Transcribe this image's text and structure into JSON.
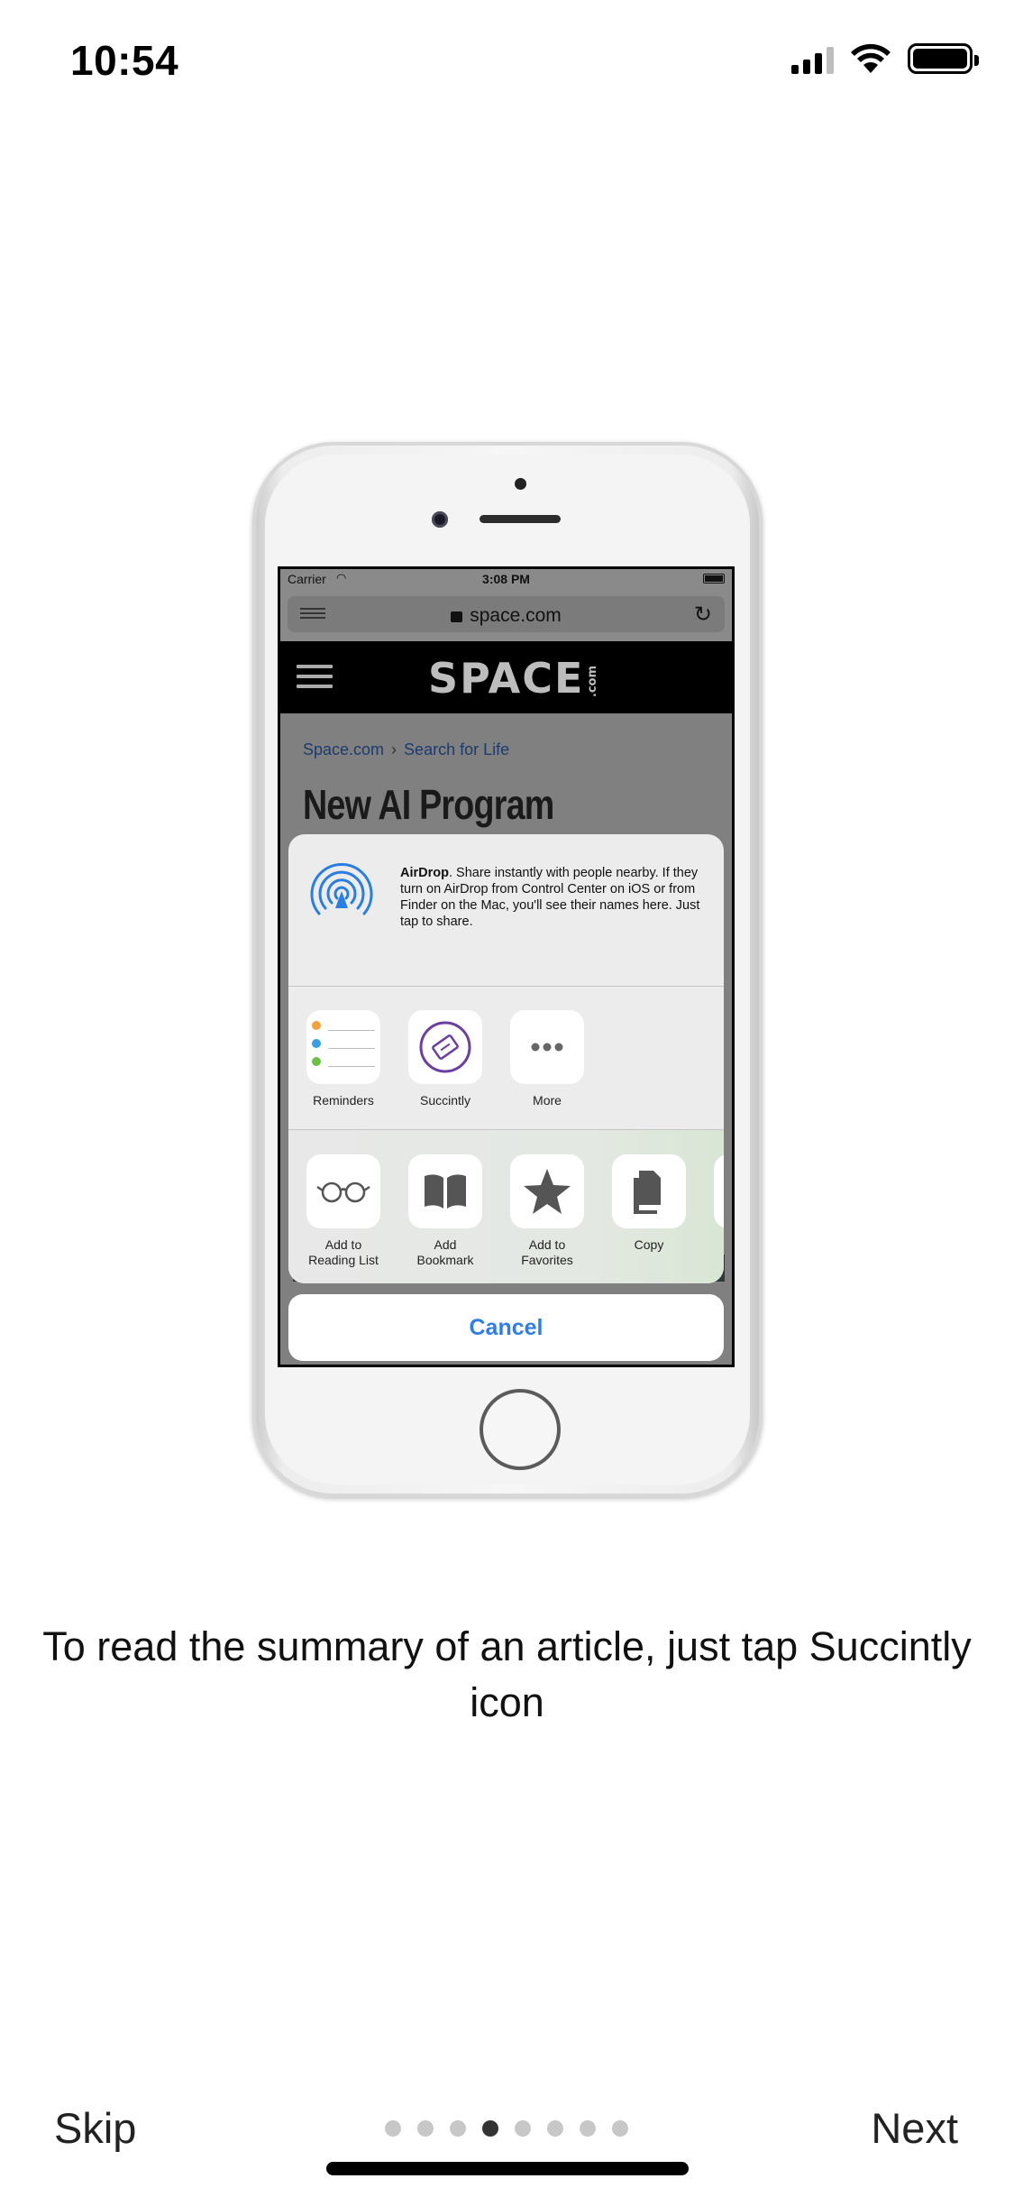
{
  "status_bar": {
    "time": "10:54"
  },
  "phone_screen": {
    "status": {
      "carrier": "Carrier",
      "time": "3:08 PM"
    },
    "url": "space.com",
    "site_logo": "SPACE",
    "site_logo_suffix": ".com",
    "breadcrumb": [
      "Space.com",
      "Search for Life"
    ],
    "headline": "New AI Program"
  },
  "share_sheet": {
    "airdrop_title": "AirDrop",
    "airdrop_text": ". Share instantly with people nearby. If they turn on AirDrop from Control Center on iOS or from Finder on the Mac, you'll see their names here. Just tap to share.",
    "apps": [
      {
        "label": "Reminders",
        "icon": "reminders-icon"
      },
      {
        "label": "Succintly",
        "icon": "succintly-icon"
      },
      {
        "label": "More",
        "icon": "more-icon"
      }
    ],
    "actions": [
      {
        "label": "Add to Reading List",
        "icon": "reading-list-icon"
      },
      {
        "label": "Add Bookmark",
        "icon": "bookmark-icon"
      },
      {
        "label": "Add to Favorites",
        "icon": "star-icon"
      },
      {
        "label": "Copy",
        "icon": "copy-icon"
      }
    ],
    "cancel": "Cancel"
  },
  "caption": "To read the summary of an article, just tap Succintly icon",
  "nav": {
    "skip": "Skip",
    "next": "Next",
    "page_count": 8,
    "current_page": 4
  },
  "colors": {
    "accent": "#2f7ee6",
    "airdrop": "#2a7de1",
    "succintly": "#6a3fa0"
  }
}
